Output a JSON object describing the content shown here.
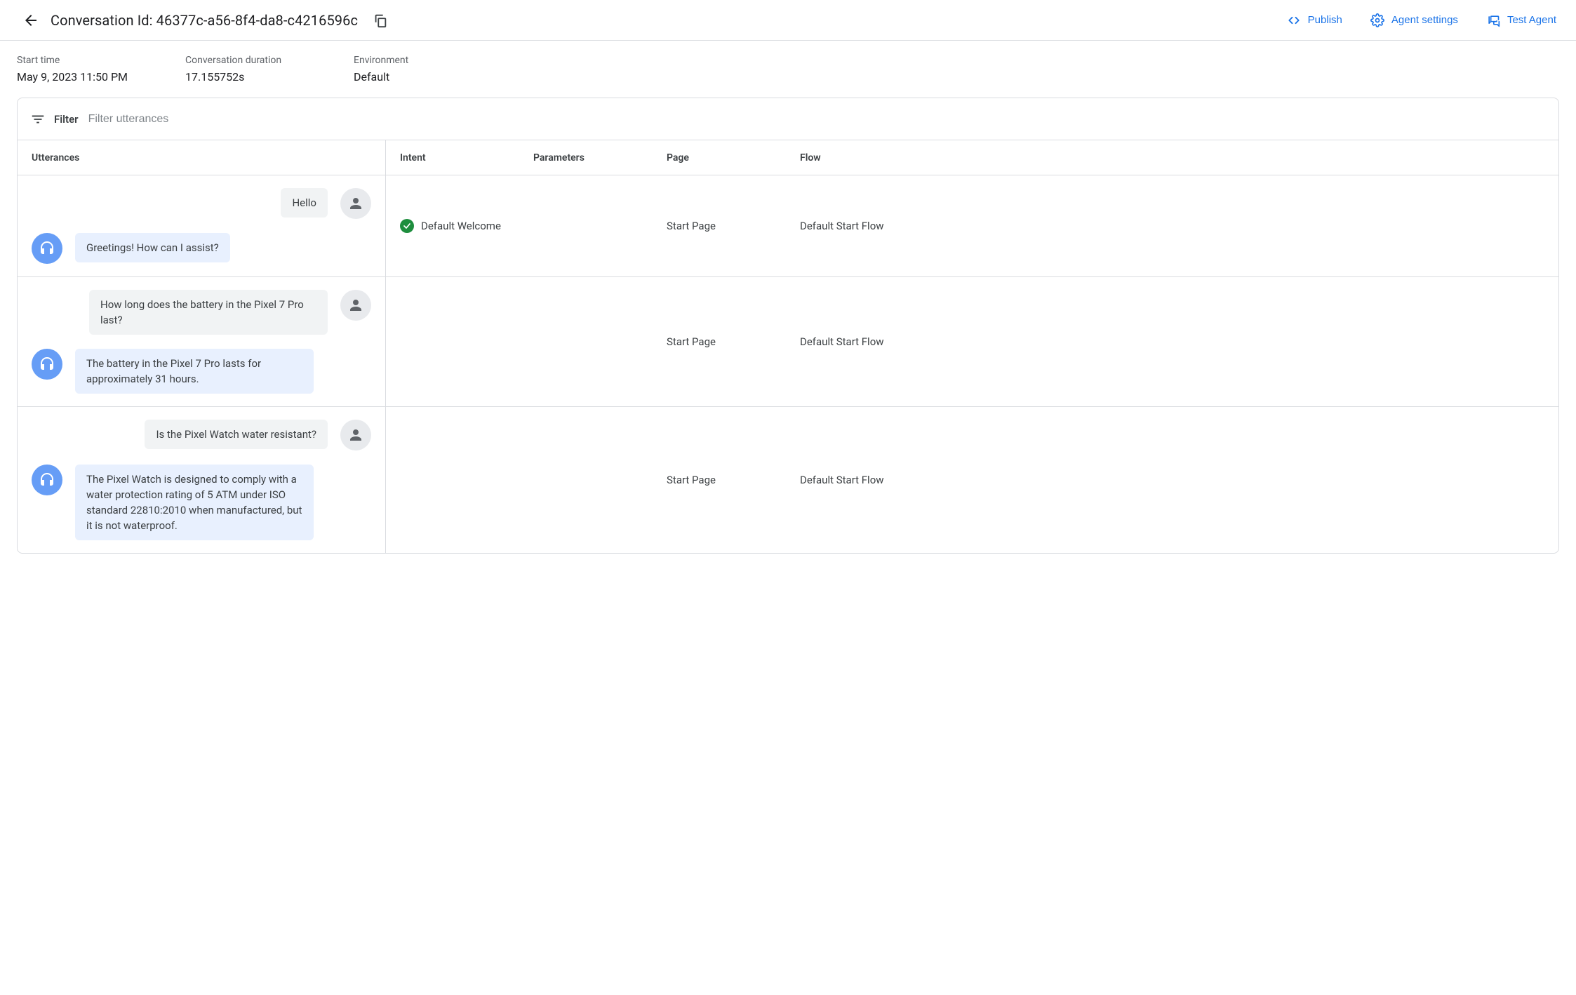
{
  "topbar": {
    "title": "Conversation Id: 46377c-a56-8f4-da8-c4216596c",
    "publish": "Publish",
    "agent_settings": "Agent settings",
    "test_agent": "Test Agent"
  },
  "meta": {
    "start_time_label": "Start time",
    "start_time_value": "May 9, 2023 11:50 PM",
    "duration_label": "Conversation duration",
    "duration_value": "17.155752s",
    "environment_label": "Environment",
    "environment_value": "Default"
  },
  "filter": {
    "label": "Filter",
    "placeholder": "Filter utterances"
  },
  "columns": {
    "utterances": "Utterances",
    "intent": "Intent",
    "parameters": "Parameters",
    "page": "Page",
    "flow": "Flow"
  },
  "rows": [
    {
      "user_msg": "Hello",
      "bot_msg": "Greetings! How can I assist?",
      "intent_matched": true,
      "intent": "Default Welcome",
      "parameters": "",
      "page": "Start Page",
      "flow": "Default Start Flow"
    },
    {
      "user_msg": "How long does the battery in the Pixel 7 Pro last?",
      "bot_msg": "The battery in the Pixel 7 Pro lasts for approximately 31 hours.",
      "intent_matched": false,
      "intent": "",
      "parameters": "",
      "page": "Start Page",
      "flow": "Default Start Flow"
    },
    {
      "user_msg": "Is the Pixel Watch water resistant?",
      "bot_msg": "The Pixel Watch is designed to comply with a water protection rating of 5 ATM under ISO standard 22810:2010 when manufactured, but it is not waterproof.",
      "intent_matched": false,
      "intent": "",
      "parameters": "",
      "page": "Start Page",
      "flow": "Default Start Flow"
    }
  ]
}
